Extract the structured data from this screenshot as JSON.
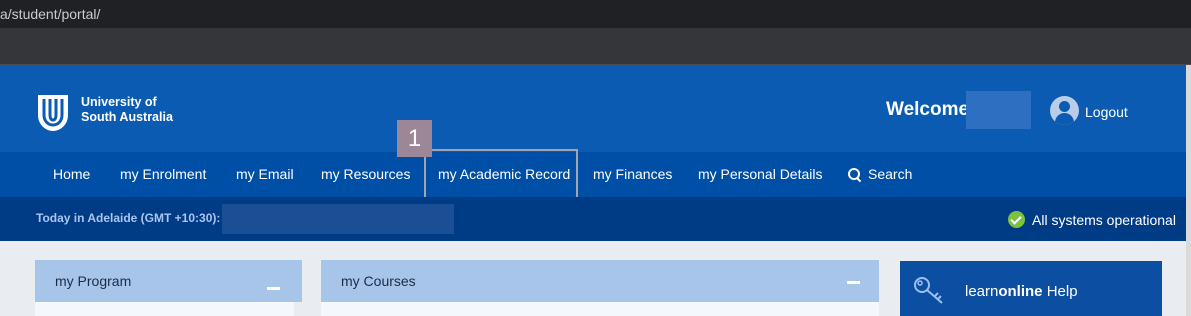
{
  "browser": {
    "url": "a/student/portal/"
  },
  "header": {
    "logo_line1": "University of",
    "logo_line2": "South Australia",
    "welcome": "Welcome",
    "logout": "Logout"
  },
  "nav": {
    "items": [
      {
        "label": "Home"
      },
      {
        "label": "my Enrolment"
      },
      {
        "label": "my Email"
      },
      {
        "label": "my Resources"
      },
      {
        "label": "my Academic Record"
      },
      {
        "label": "my Finances"
      },
      {
        "label": "my Personal Details"
      },
      {
        "label": "Search"
      }
    ]
  },
  "step_badge": "1",
  "status": {
    "today": "Today in Adelaide (GMT +10:30):",
    "systems": "All systems operational"
  },
  "panels": {
    "program": "my Program",
    "courses": "my Courses"
  },
  "help": {
    "prefix": "learn",
    "bold": "online",
    "suffix": " Help"
  },
  "colors": {
    "header": "#0b5bb3",
    "nav": "#004fa6",
    "statusbar": "#003b85",
    "panel_header": "#a6c5e8",
    "status_ok": "#7cc242"
  }
}
